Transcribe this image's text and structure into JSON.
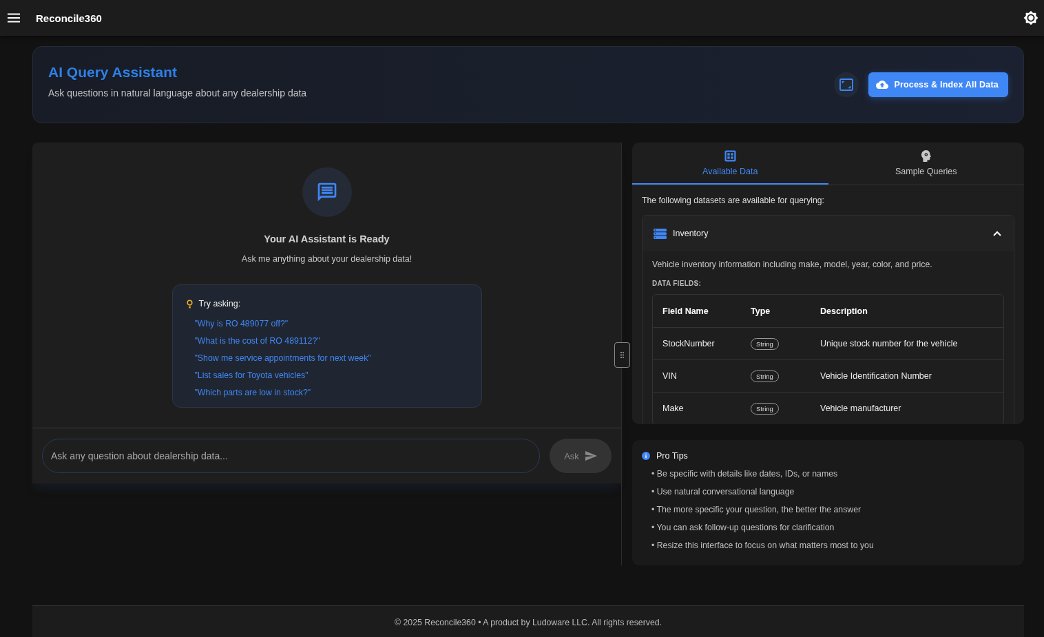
{
  "app_bar": {
    "title": "Reconcile360"
  },
  "header": {
    "title": "AI Query Assistant",
    "subtitle": "Ask questions in natural language about any dealership data",
    "action_button": "Process & Index All Data"
  },
  "chat": {
    "title": "Your AI Assistant is Ready",
    "subtitle": "Ask me anything about your dealership data!",
    "suggestions_heading": "Try asking:",
    "suggestions": [
      "\"Why is RO 489077 off?\"",
      "\"What is the cost of RO 489112?\"",
      "\"Show me service appointments for next week\"",
      "\"List sales for Toyota vehicles\"",
      "\"Which parts are low in stock?\""
    ],
    "input": {
      "placeholder": "Ask any question about dealership data..."
    },
    "ask_button": {
      "label": "Ask",
      "disabled": true
    }
  },
  "tabs": [
    {
      "label": "Available Data",
      "selected": true
    },
    {
      "label": "Sample Queries",
      "selected": false
    }
  ],
  "available_data": {
    "intro": "The following datasets are available for querying:",
    "datasets": [
      {
        "name": "Inventory",
        "expanded": true,
        "description": "Vehicle inventory information including make, model, year, color, and price.",
        "fields_heading": "DATA FIELDS:",
        "columns": [
          "Field Name",
          "Type",
          "Description"
        ],
        "rows": [
          {
            "field": "StockNumber",
            "type": "String",
            "description": "Unique stock number for the vehicle"
          },
          {
            "field": "VIN",
            "type": "String",
            "description": "Vehicle Identification Number"
          },
          {
            "field": "Make",
            "type": "String",
            "description": "Vehicle manufacturer"
          }
        ]
      }
    ]
  },
  "pro_tips": {
    "title": "Pro Tips",
    "items": [
      "• Be specific with details like dates, IDs, or names",
      "• Use natural conversational language",
      "• The more specific your question, the better the answer",
      "• You can ask follow-up questions for clarification",
      "• Resize this interface to focus on what matters most to you"
    ]
  },
  "footer": {
    "text": "© 2025 Reconcile360 • A product by Ludoware LLC. All rights reserved."
  }
}
